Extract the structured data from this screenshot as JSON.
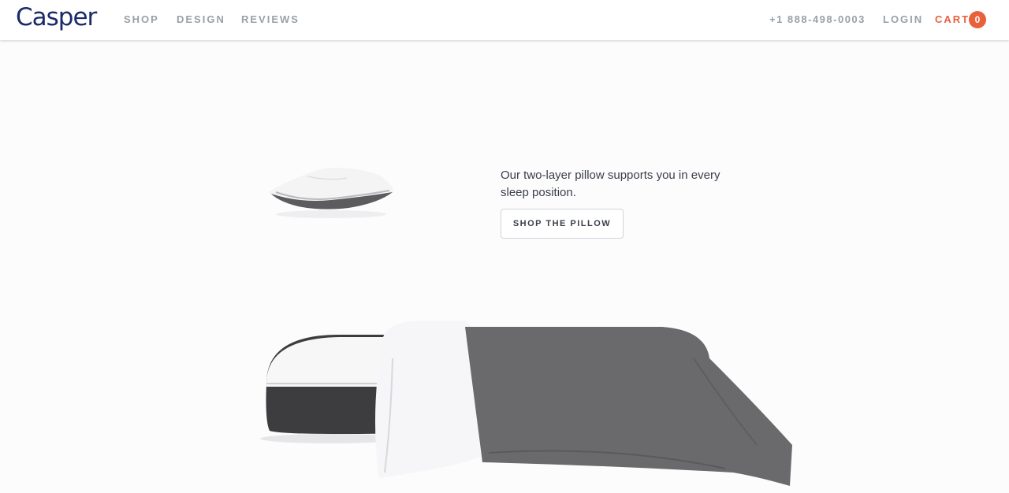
{
  "header": {
    "logo": "Casper",
    "nav": [
      "SHOP",
      "DESIGN",
      "REVIEWS"
    ],
    "phone": "+1 888-498-0003",
    "login": "LOGIN",
    "cart_label": "CART",
    "cart_count": "0"
  },
  "hero": {
    "tagline": "Our two-layer pillow supports you in every sleep position.",
    "cta": "SHOP THE PILLOW"
  },
  "colors": {
    "brand": "#1b2a6b",
    "accent": "#e8603c",
    "nav_text": "#9aa0a8"
  }
}
